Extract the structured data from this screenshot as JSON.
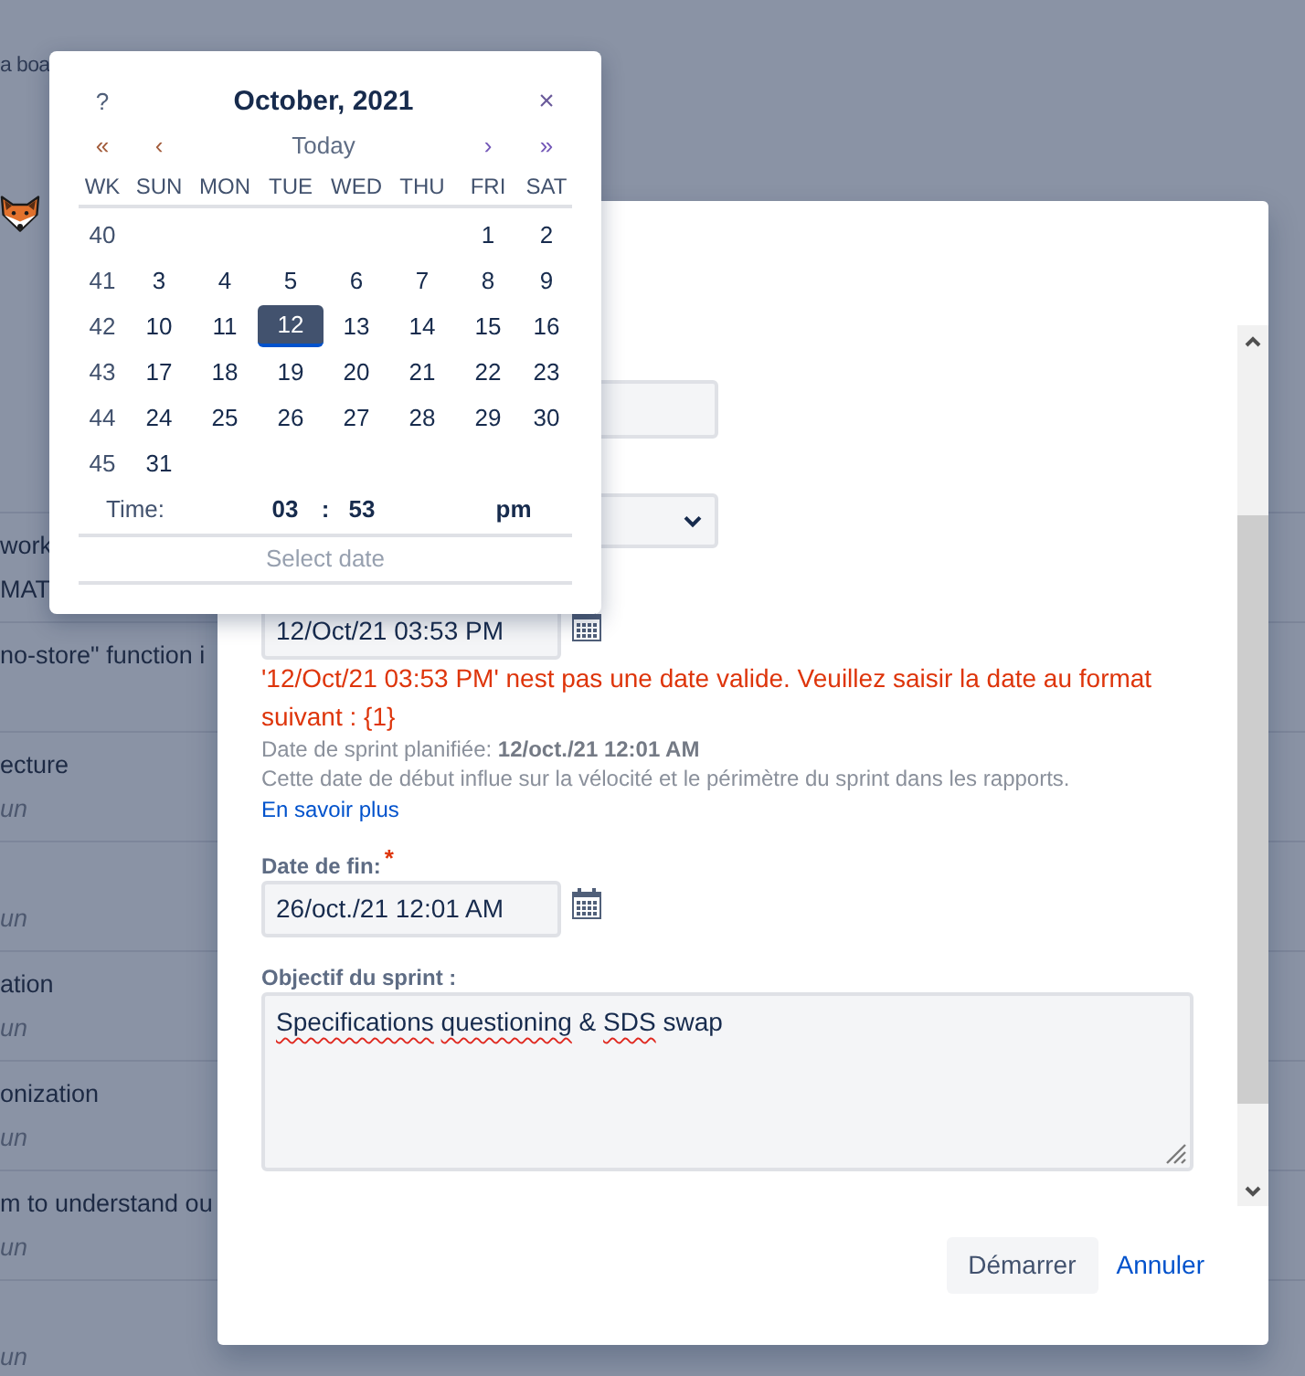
{
  "board": {
    "header_text": "a boa",
    "rows": [
      {
        "title": "work",
        "subtitle": "MAT",
        "italic": false
      },
      {
        "title": "no-store\" function i"
      },
      {
        "title": "ecture",
        "subtitle": "un",
        "italic": true
      },
      {
        "subtitle": "un",
        "italic": true
      },
      {
        "title": "ation",
        "subtitle": "un",
        "italic": true
      },
      {
        "title": "onization",
        "subtitle": "un",
        "italic": true
      },
      {
        "title": "m to understand ou",
        "subtitle": "un",
        "italic": true
      },
      {
        "subtitle": "un",
        "italic": true
      }
    ]
  },
  "modal": {
    "fields": [
      {
        "kind": "text"
      },
      {
        "kind": "select"
      },
      {
        "kind": "date",
        "value": "12/Oct/21 03:53 PM",
        "error": "'12/Oct/21 03:53 PM' nest pas une date valide. Veuillez saisir la date au format suivant : {1}",
        "planned": "Date de sprint planifiée: **12/oct./21 12:01 AM**",
        "help": "Cette date de début influe sur la vélocité et le périmètre du sprint dans les rapports.",
        "help_link": "En savoir plus"
      },
      {
        "kind": "date",
        "label": "Date de fin:",
        "required_mark": "*",
        "value": "26/oct./21 12:01 AM"
      },
      {
        "kind": "textarea",
        "label": "Objectif du sprint :",
        "words": [
          {
            "text": "Specifications",
            "misspelled": true
          },
          {
            "text": "questioning",
            "misspelled": true
          },
          {
            "text": "&",
            "misspelled": false
          },
          {
            "text": "SDS",
            "misspelled": true
          },
          {
            "text": "swap",
            "misspelled": false
          }
        ]
      }
    ],
    "buttons": [
      {
        "label": "Démarrer",
        "kind": "button"
      },
      {
        "label": "Annuler",
        "kind": "link"
      }
    ]
  },
  "date_picker": {
    "help": "?",
    "title": "October, 2021",
    "close": "×",
    "nav": [
      {
        "label": "«",
        "kind": "prev_year"
      },
      {
        "label": "‹",
        "kind": "prev_month"
      },
      {
        "label": "Today",
        "kind": "today"
      },
      {
        "label": "›",
        "kind": "next_month"
      },
      {
        "label": "»",
        "kind": "next_year"
      }
    ],
    "columns": [
      "WK",
      "SUN",
      "MON",
      "TUE",
      "WED",
      "THU",
      "FRI",
      "SAT"
    ],
    "weeks": [
      {
        "number": "40",
        "days": [
          {
            "day": "1",
            "selected": false
          },
          {
            "day": "2",
            "selected": false
          }
        ]
      },
      {
        "number": "41",
        "days": [
          {
            "day": "3",
            "selected": false
          },
          {
            "day": "4",
            "selected": false
          },
          {
            "day": "5",
            "selected": false
          },
          {
            "day": "6",
            "selected": false
          },
          {
            "day": "7",
            "selected": false
          },
          {
            "day": "8",
            "selected": false
          },
          {
            "day": "9",
            "selected": false
          }
        ]
      },
      {
        "number": "42",
        "days": [
          {
            "day": "10",
            "selected": false
          },
          {
            "day": "11",
            "selected": false
          },
          {
            "day": "12",
            "selected": true
          },
          {
            "day": "13",
            "selected": false
          },
          {
            "day": "14",
            "selected": false
          },
          {
            "day": "15",
            "selected": false
          },
          {
            "day": "16",
            "selected": false
          }
        ]
      },
      {
        "number": "43",
        "days": [
          {
            "day": "17",
            "selected": false
          },
          {
            "day": "18",
            "selected": false
          },
          {
            "day": "19",
            "selected": false
          },
          {
            "day": "20",
            "selected": false
          },
          {
            "day": "21",
            "selected": false
          },
          {
            "day": "22",
            "selected": false
          },
          {
            "day": "23",
            "selected": false
          }
        ]
      },
      {
        "number": "44",
        "days": [
          {
            "day": "24",
            "selected": false
          },
          {
            "day": "25",
            "selected": false
          },
          {
            "day": "26",
            "selected": false
          },
          {
            "day": "27",
            "selected": false
          },
          {
            "day": "28",
            "selected": false
          },
          {
            "day": "29",
            "selected": false
          },
          {
            "day": "30",
            "selected": false
          }
        ]
      },
      {
        "number": "45",
        "days": [
          {
            "day": "31",
            "selected": false
          }
        ]
      }
    ],
    "time": {
      "label": "Time:",
      "hours": "03",
      "separator": ":",
      "minutes": "53",
      "period": "pm"
    },
    "footer": "Select date"
  }
}
